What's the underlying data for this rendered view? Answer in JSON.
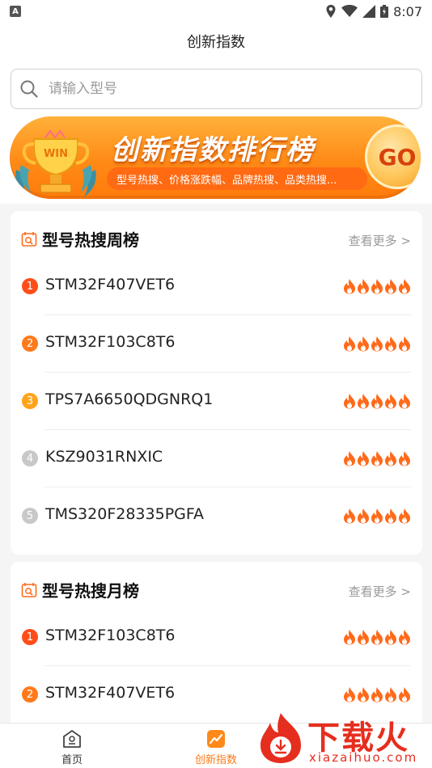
{
  "status": {
    "time": "8:07",
    "a_label": "A"
  },
  "header": {
    "title": "创新指数"
  },
  "search": {
    "placeholder": "请输入型号"
  },
  "banner": {
    "title": "创新指数排行榜",
    "subtitle": "型号热搜、价格涨跌幅、品牌热搜、品类热搜...",
    "go_label": "GO",
    "trophy_label": "WIN"
  },
  "weekly": {
    "title": "型号热搜周榜",
    "more": "查看更多 >",
    "items": [
      {
        "rank": "1",
        "name": "STM32F407VET6"
      },
      {
        "rank": "2",
        "name": "STM32F103C8T6"
      },
      {
        "rank": "3",
        "name": "TPS7A6650QDGNRQ1"
      },
      {
        "rank": "4",
        "name": "KSZ9031RNXIC"
      },
      {
        "rank": "5",
        "name": "TMS320F28335PGFA"
      }
    ]
  },
  "monthly": {
    "title": "型号热搜月榜",
    "more": "查看更多 >",
    "items": [
      {
        "rank": "1",
        "name": "STM32F103C8T6"
      },
      {
        "rank": "2",
        "name": "STM32F407VET6"
      }
    ]
  },
  "nav": {
    "home": "首页",
    "index": "创新指数"
  },
  "watermark": {
    "brand": "下载火",
    "domain": "xiazaihuo.com"
  },
  "colors": {
    "rank1": "#ff4d1a",
    "rank2": "#ff7a1a",
    "rank3": "#ffa31a",
    "rank_other": "#c8c8c8",
    "flame": "#ff6a1a",
    "accent": "#ff8a16"
  },
  "icons": [
    "search-icon",
    "trophy-icon",
    "calendar-search-icon",
    "flame-icon",
    "home-icon",
    "chart-icon",
    "location-icon",
    "wifi-icon",
    "signal-icon",
    "battery-icon"
  ]
}
